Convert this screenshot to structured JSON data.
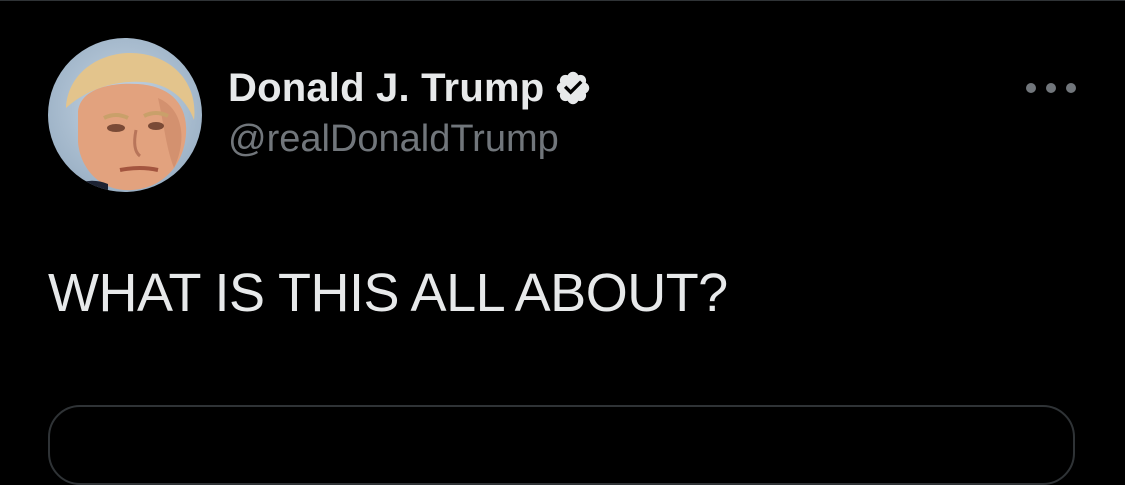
{
  "tweet": {
    "author": {
      "display_name": "Donald J. Trump",
      "handle": "@realDonaldTrump",
      "verified": true,
      "avatar_icon": "profile-photo"
    },
    "text": "WHAT IS THIS ALL ABOUT?",
    "more_icon": "ellipsis-icon"
  },
  "colors": {
    "background": "#000000",
    "primary_text": "#e7e9ea",
    "secondary_text": "#71767b",
    "border": "#2f3336",
    "verified_badge": "#e7e9ea"
  }
}
